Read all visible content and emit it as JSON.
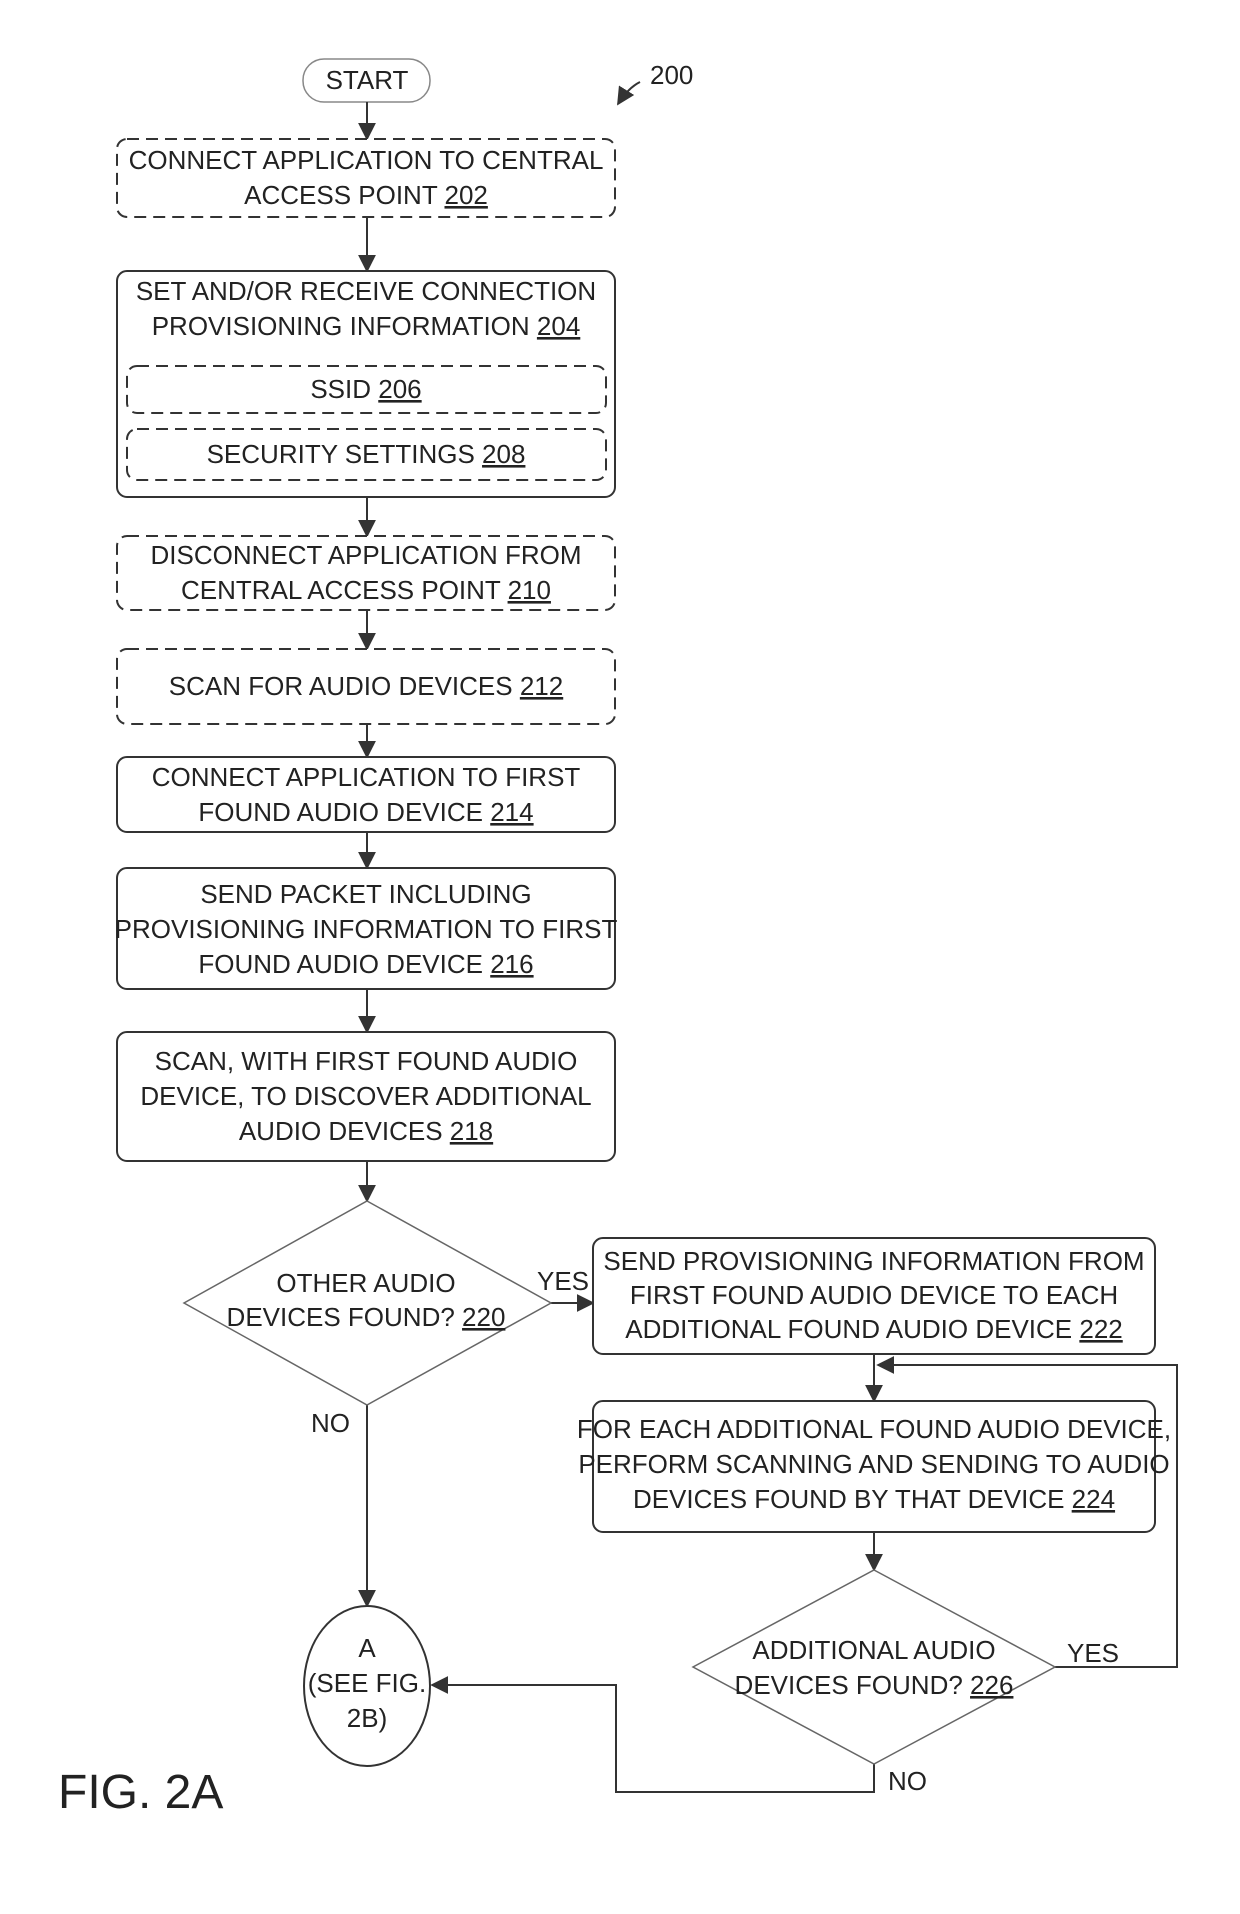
{
  "diagram": {
    "reference_number": "200",
    "figure_label": "FIG. 2A",
    "start": "START",
    "steps": {
      "s202": {
        "lines": [
          "CONNECT APPLICATION TO CENTRAL",
          "ACCESS POINT "
        ],
        "ref": "202"
      },
      "s204": {
        "lines": [
          "SET AND/OR RECEIVE CONNECTION",
          "PROVISIONING INFORMATION "
        ],
        "ref": "204"
      },
      "s206": {
        "lines": [
          "SSID "
        ],
        "ref": "206"
      },
      "s208": {
        "lines": [
          "SECURITY SETTINGS "
        ],
        "ref": "208"
      },
      "s210": {
        "lines": [
          "DISCONNECT APPLICATION FROM",
          "CENTRAL ACCESS POINT "
        ],
        "ref": "210"
      },
      "s212": {
        "lines": [
          "SCAN FOR AUDIO DEVICES "
        ],
        "ref": "212"
      },
      "s214": {
        "lines": [
          "CONNECT APPLICATION TO FIRST",
          "FOUND AUDIO DEVICE "
        ],
        "ref": "214"
      },
      "s216": {
        "lines": [
          "SEND PACKET INCLUDING",
          "PROVISIONING INFORMATION TO FIRST",
          "FOUND AUDIO DEVICE "
        ],
        "ref": "216"
      },
      "s218": {
        "lines": [
          "SCAN, WITH FIRST FOUND AUDIO",
          "DEVICE, TO DISCOVER ADDITIONAL",
          "AUDIO DEVICES "
        ],
        "ref": "218"
      },
      "s220": {
        "lines": [
          "OTHER AUDIO",
          "DEVICES FOUND? "
        ],
        "ref": "220"
      },
      "s222": {
        "lines": [
          "SEND PROVISIONING INFORMATION FROM",
          "FIRST FOUND AUDIO DEVICE TO EACH",
          "ADDITIONAL FOUND AUDIO DEVICE "
        ],
        "ref": "222"
      },
      "s224": {
        "lines": [
          "FOR EACH ADDITIONAL FOUND AUDIO DEVICE,",
          "PERFORM SCANNING AND SENDING TO AUDIO",
          "DEVICES FOUND BY THAT DEVICE "
        ],
        "ref": "224"
      },
      "s226": {
        "lines": [
          "ADDITIONAL AUDIO",
          "DEVICES FOUND? "
        ],
        "ref": "226"
      }
    },
    "connector": {
      "lines": [
        "A",
        "(SEE FIG.",
        "2B)"
      ]
    },
    "edge_labels": {
      "yes1": "YES",
      "no1": "NO",
      "yes2": "YES",
      "no2": "NO"
    }
  }
}
